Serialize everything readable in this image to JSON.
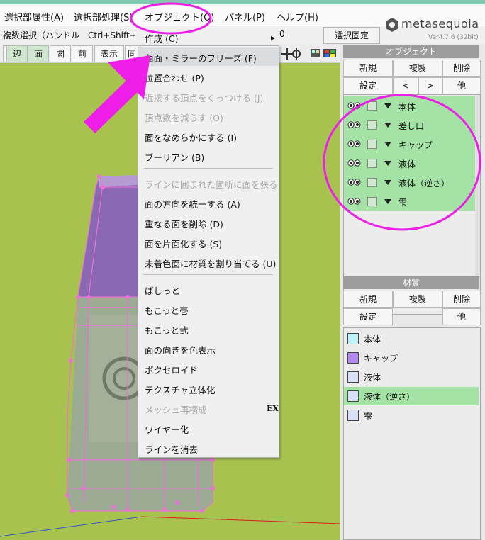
{
  "menubar": {
    "items": [
      "選択部属性(A)",
      "選択部処理(S)",
      "オブジェクト(O)",
      "パネル(P)",
      "ヘルプ(H)"
    ]
  },
  "logo": {
    "name": "metasequoia",
    "version": "Ver4.7.6 (32bit)"
  },
  "toolbar1": {
    "multi_select": "複数選択（ハンドル　Ctrl+Shift+L",
    "value": "0",
    "fix_selection": "選択固定"
  },
  "toolbar2": {
    "buttons": [
      "辺",
      "面",
      "閻",
      "前",
      "表示",
      "同"
    ]
  },
  "object_menu": {
    "items": [
      {
        "label": "作成 (C)",
        "enabled": true,
        "submenu": true
      },
      {
        "label": "曲面・ミラーのフリーズ (F)",
        "enabled": true,
        "highlighted": true
      },
      {
        "label": "位置合わせ (P)",
        "enabled": true
      },
      {
        "label": "近接する頂点をくっつける (J)",
        "enabled": false
      },
      {
        "label": "頂点数を減らす (O)",
        "enabled": false
      },
      {
        "label": "面をなめらかにする (I)",
        "enabled": true
      },
      {
        "label": "ブーリアン (B)",
        "enabled": true
      },
      {
        "label": "ラインに囲まれた箇所に面を張る",
        "enabled": false
      },
      {
        "label": "面の方向を統一する (A)",
        "enabled": true
      },
      {
        "label": "重なる面を削除 (D)",
        "enabled": true
      },
      {
        "label": "面を片面化する (S)",
        "enabled": true
      },
      {
        "label": "未着色面に材質を割り当てる (U)",
        "enabled": true
      },
      {
        "label": "ぱしっと",
        "enabled": true
      },
      {
        "label": "もこっと壱",
        "enabled": true
      },
      {
        "label": "もこっと弐",
        "enabled": true
      },
      {
        "label": "面の向きを色表示",
        "enabled": true
      },
      {
        "label": "ボクセロイド",
        "enabled": true
      },
      {
        "label": "テクスチャ立体化",
        "enabled": true
      },
      {
        "label": "メッシュ再構成",
        "enabled": false,
        "badge": "EX"
      },
      {
        "label": "ワイヤー化",
        "enabled": true
      },
      {
        "label": "ラインを消去",
        "enabled": true
      }
    ]
  },
  "object_panel": {
    "title": "オブジェクト",
    "buttons_row1": [
      "新規",
      "複製",
      "削除"
    ],
    "buttons_row2": [
      "設定",
      "<",
      ">",
      "他"
    ],
    "objects": [
      "本体",
      "差し口",
      "キャップ",
      "液体",
      "液体（逆さ）",
      "雫"
    ]
  },
  "material_panel": {
    "title": "材質",
    "buttons_row1": [
      "新規",
      "複製",
      "削除"
    ],
    "buttons_row2": [
      "設定",
      "他"
    ],
    "materials": [
      {
        "name": "本体",
        "color": "#bff3f8"
      },
      {
        "name": "キャップ",
        "color": "#b58af0"
      },
      {
        "name": "液体",
        "color": "#d9e1f8"
      },
      {
        "name": "液体（逆さ）",
        "color": "#d9e1f8",
        "selected": true
      },
      {
        "name": "雫",
        "color": "#d9e1f8"
      }
    ]
  },
  "colors": {
    "annotation": "#ee1ee8",
    "selected_row": "#a4e2a5",
    "viewport_bg": "#a8c24f"
  }
}
